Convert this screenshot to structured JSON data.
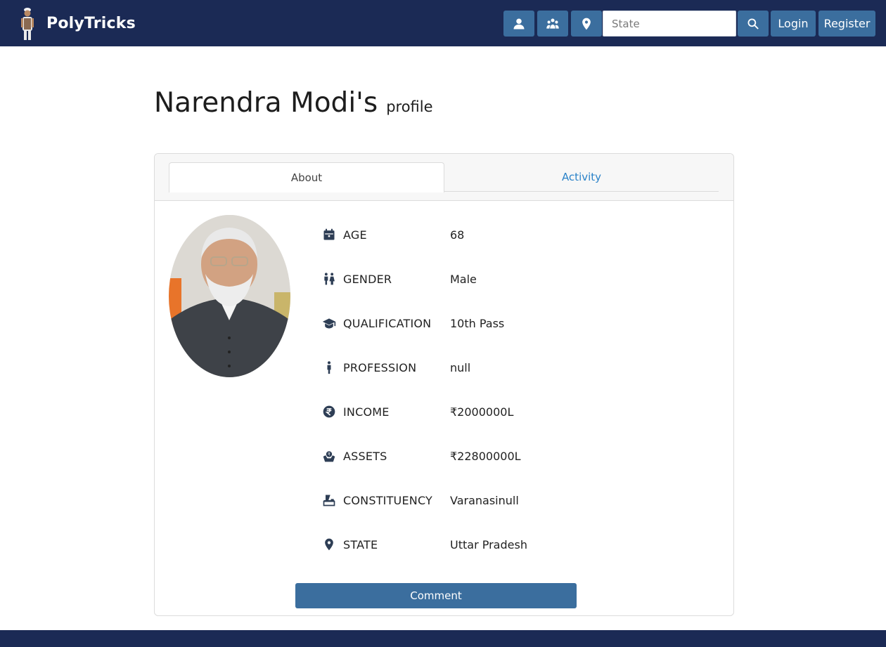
{
  "header": {
    "brand": "PolyTricks",
    "search_placeholder": "State",
    "login_label": "Login",
    "register_label": "Register",
    "icons": [
      "user-icon",
      "group-icon",
      "location-pin-icon",
      "search-icon"
    ]
  },
  "page": {
    "name": "Narendra Modi's",
    "subtitle": "profile"
  },
  "tabs": [
    {
      "label": "About",
      "active": true
    },
    {
      "label": "Activity",
      "active": false
    }
  ],
  "profile": {
    "fields": [
      {
        "icon": "calendar-icon",
        "label": "AGE",
        "value": "68"
      },
      {
        "icon": "gender-icon",
        "label": "GENDER",
        "value": "Male"
      },
      {
        "icon": "graduation-cap-icon",
        "label": "QUALIFICATION",
        "value": "10th Pass"
      },
      {
        "icon": "person-icon",
        "label": "PROFESSION",
        "value": "null"
      },
      {
        "icon": "rupee-icon",
        "label": "INCOME",
        "value": "₹2000000L"
      },
      {
        "icon": "hand-money-icon",
        "label": "ASSETS",
        "value": "₹22800000L"
      },
      {
        "icon": "ballot-box-icon",
        "label": "CONSTITUENCY",
        "value": "Varanasinull"
      },
      {
        "icon": "location-pin-icon",
        "label": "STATE",
        "value": "Uttar Pradesh"
      }
    ]
  },
  "comment_label": "Comment",
  "colors": {
    "navbar": "#1b2a55",
    "button": "#3b6e9e",
    "tab_link": "#2a82c8"
  }
}
